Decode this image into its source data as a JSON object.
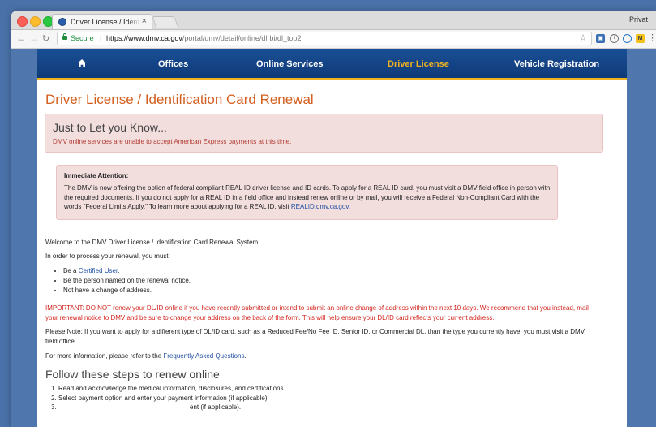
{
  "browser": {
    "tab_title": "Driver License / Identification C",
    "tab_close": "×",
    "profile_label": "Privat",
    "secure_label": "Secure",
    "url_host": "https://www.dmv.ca.gov",
    "url_path": "/portal/dmv/detail/online/dlrbi/dl_top2",
    "extension_badge": "M"
  },
  "nav": {
    "items": [
      "Offices",
      "Online Services",
      "Driver License",
      "Vehicle Registration"
    ],
    "active": "Driver License"
  },
  "page": {
    "title": "Driver License / Identification Card Renewal",
    "notice": {
      "heading": "Just to Let you Know...",
      "message": "DMV online services are unable to accept American Express payments at this time."
    },
    "attention": {
      "heading": "Immediate Attention:",
      "body": "The DMV is now offering the option of federal compliant REAL ID driver license and ID cards. To apply for a REAL ID card, you must visit a DMV field office in person with the required documents. If you do not apply for a REAL ID in a field office and instead renew online or by mail, you will receive a Federal Non-Compliant Card with the words \"Federal Limits Apply.\" To learn more about applying for a REAL ID, visit ",
      "link": "REALID.dmv.ca.gov",
      "tail": "."
    },
    "welcome": "Welcome to the DMV Driver License / Identification Card Renewal System.",
    "process_intro": "In order to process your renewal, you must:",
    "requirements": {
      "item1_prefix": "Be a ",
      "item1_link": "Certified User",
      "item1_suffix": ".",
      "item2": "Be the person named on the renewal notice.",
      "item3": "Not have a change of address."
    },
    "important": "IMPORTANT: DO NOT renew your DL/ID online if you have recently submitted or intend to submit an online change of address within the next 10 days. We recommend that you instead, mail your renewal notice to DMV and be sure to change your address on the back of the form. This will help ensure your DL/ID card reflects your current address.",
    "please_note": "Please Note: If you want to apply for a different type of DL/ID card, such as a Reduced Fee/No Fee ID, Senior ID, or Commercial DL, than the type you currently have, you must visit a DMV field office.",
    "faq_prefix": "For more information, please refer to the ",
    "faq_link": "Frequently Asked Questions",
    "faq_suffix": ".",
    "steps_heading": "Follow these steps to renew online",
    "steps": {
      "step1": "Read and acknowledge the medical information, disclosures, and certifications.",
      "step2": "Select payment option and enter your payment information (if applicable).",
      "step3_visible": "ent (if applicable)."
    }
  },
  "colors": {
    "title_orange": "#d35f1f",
    "nav_blue": "#1a4f96",
    "nav_active_gold": "#f1b21f",
    "alert_bg": "#f3dede",
    "important_red": "#d3241c",
    "link_blue": "#1f4ea3"
  }
}
